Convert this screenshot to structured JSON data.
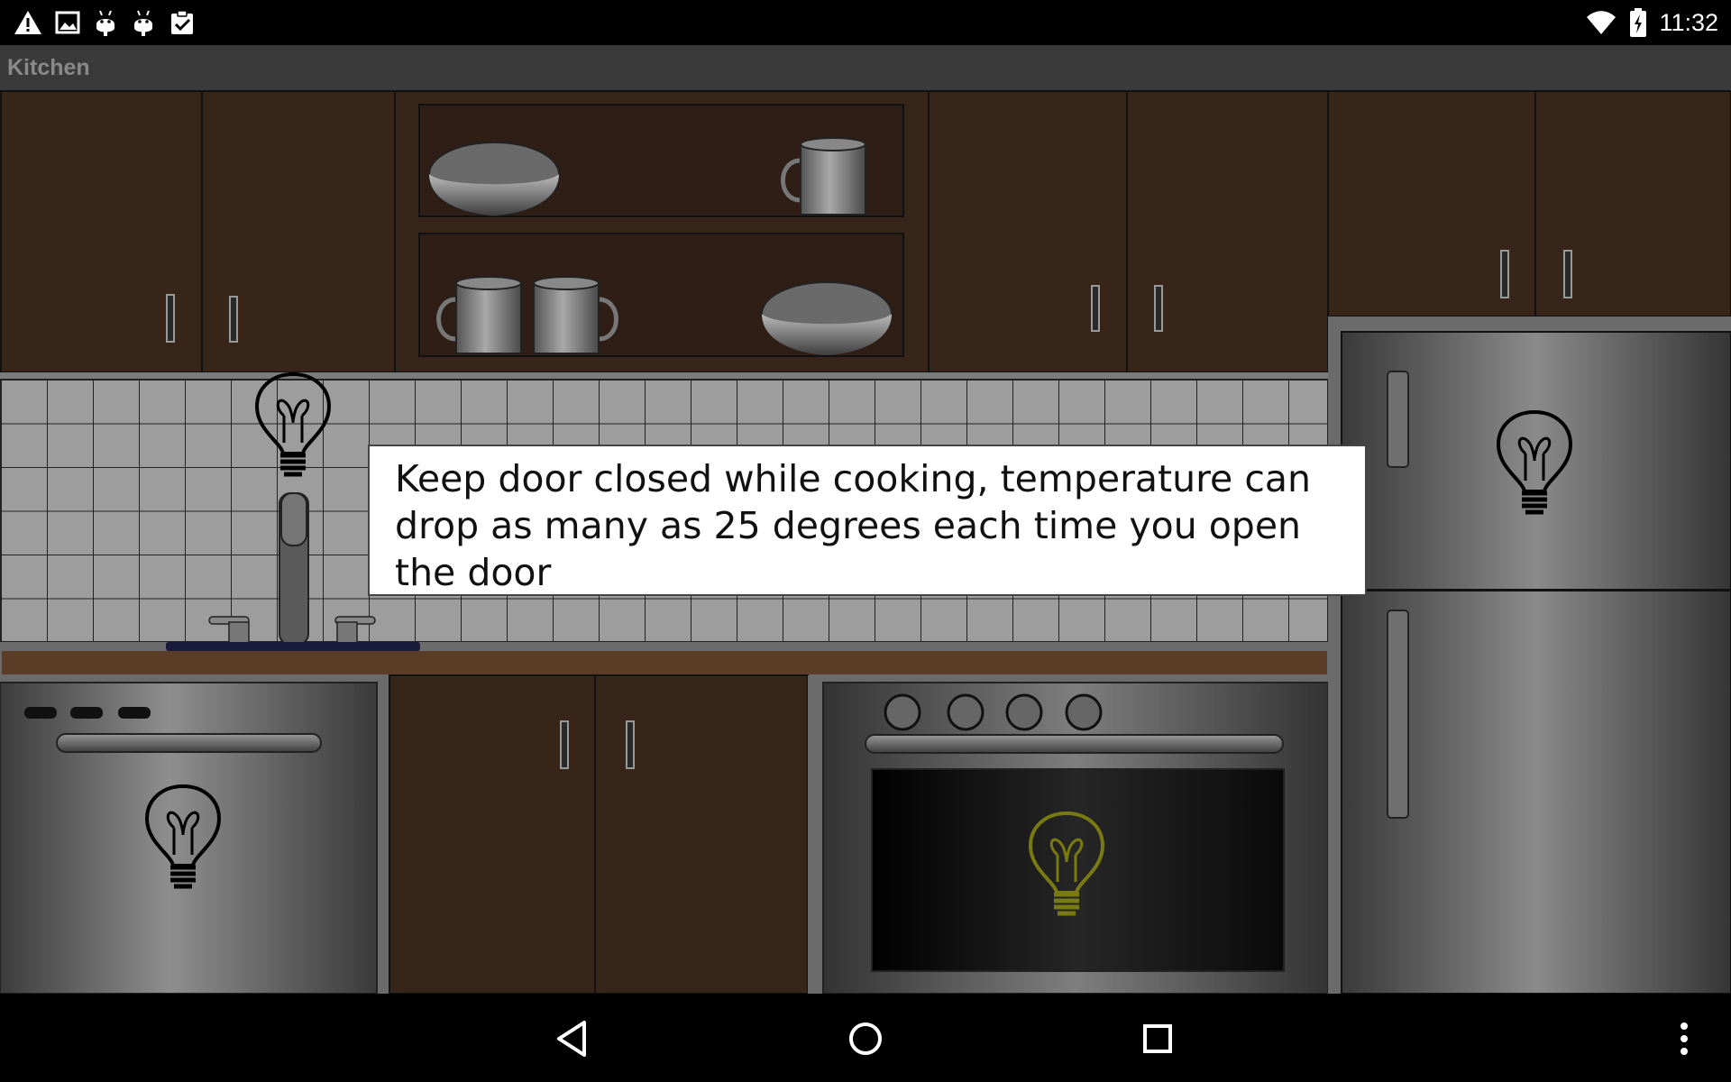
{
  "status_bar": {
    "time": "11:32",
    "left_icons": [
      "warning-icon",
      "image-icon",
      "android-icon",
      "android-icon",
      "clipboard-check-icon"
    ],
    "right_icons": [
      "wifi-icon",
      "battery-charging-icon"
    ]
  },
  "app": {
    "title": "Kitchen"
  },
  "tip": {
    "text": "Keep door closed while cooking, temperature can drop as many as 25  degrees each time you open the door"
  },
  "appliances": [
    {
      "name": "Sink light",
      "light_on": false
    },
    {
      "name": "Refrigerator light",
      "light_on": false
    },
    {
      "name": "Dishwasher light",
      "light_on": false
    },
    {
      "name": "Oven light",
      "light_on": true
    }
  ],
  "colors": {
    "cabinet": "#38251a",
    "tile": "#9d9d9d",
    "steel": "#6d6d6d",
    "bulb_off": "#000000",
    "bulb_on": "#7a7a12"
  },
  "nav_bar": {
    "buttons": [
      "back-icon",
      "home-icon",
      "recents-icon",
      "overflow-menu-icon"
    ]
  }
}
